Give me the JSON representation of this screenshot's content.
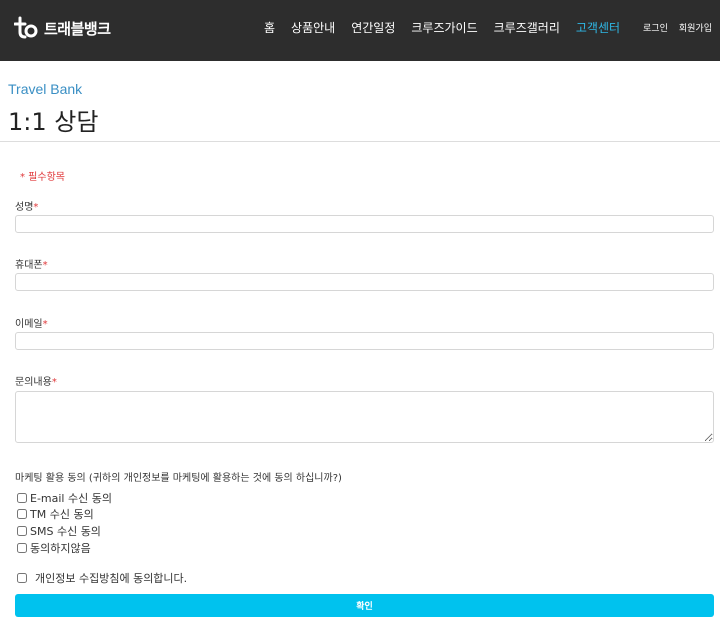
{
  "header": {
    "logo_text": "트래블뱅크",
    "nav": [
      {
        "label": "홈",
        "active": false
      },
      {
        "label": "상품안내",
        "active": false
      },
      {
        "label": "연간일정",
        "active": false
      },
      {
        "label": "크루즈가이드",
        "active": false
      },
      {
        "label": "크루즈갤러리",
        "active": false
      },
      {
        "label": "고객센터",
        "active": true
      }
    ],
    "login_label": "로그인",
    "signup_label": "회원가입"
  },
  "page": {
    "brand": "Travel Bank",
    "title": "1:1 상담",
    "required_note": "* 필수항목"
  },
  "form": {
    "name_label": "성명",
    "phone_label": "휴대폰",
    "email_label": "이메일",
    "inquiry_label": "문의내용",
    "required_mark": "*",
    "name_value": "",
    "phone_value": "",
    "email_value": "",
    "inquiry_value": "",
    "marketing_label": "마케팅 활용 동의 (귀하의 개인정보를 마케팅에 활용하는 것에 동의 하십니까?)",
    "marketing_options": [
      {
        "label": "E-mail 수신 동의",
        "checked": false
      },
      {
        "label": "TM 수신 동의",
        "checked": false
      },
      {
        "label": "SMS 수신 동의",
        "checked": false
      },
      {
        "label": "동의하지않음",
        "checked": false
      }
    ],
    "privacy_label": "개인정보 수집방침에 동의합니다.",
    "privacy_checked": false,
    "submit_label": "확인"
  },
  "colors": {
    "header_bg": "#2d2d2d",
    "nav_active": "#2fb8e6",
    "brand_blue": "#3a8fc4",
    "required_red": "#e0383a",
    "submit_bg": "#00c2ee"
  }
}
